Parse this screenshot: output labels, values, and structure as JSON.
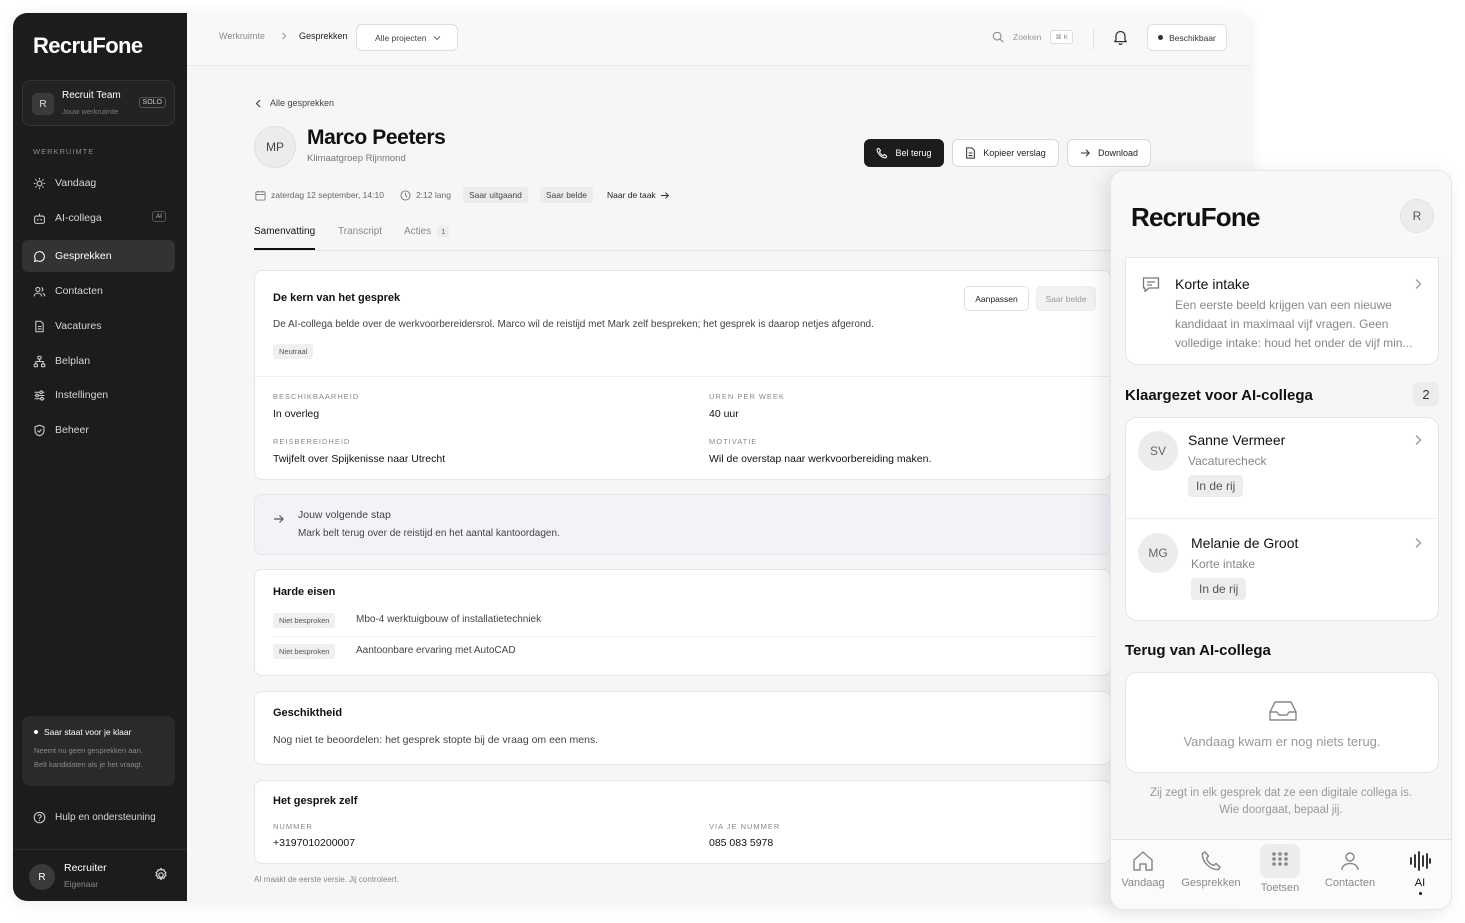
{
  "app": {
    "name": "RecruFone"
  },
  "sidebar": {
    "team_name": "Recruit Team",
    "team_sub": "Jouw werkruimte",
    "team_badge": "SOLO",
    "team_initial": "R",
    "section_label": "WERKRUIMTE",
    "items": [
      {
        "label": "Vandaag",
        "icon": "sun-icon"
      },
      {
        "label": "AI-collega",
        "icon": "robot-icon",
        "badge": "AI"
      },
      {
        "label": "Gesprekken",
        "icon": "chat-icon",
        "active": true
      },
      {
        "label": "Contacten",
        "icon": "people-icon"
      },
      {
        "label": "Vacatures",
        "icon": "document-icon"
      },
      {
        "label": "Belplan",
        "icon": "flow-icon"
      },
      {
        "label": "Instellingen",
        "icon": "sliders-icon"
      },
      {
        "label": "Beheer",
        "icon": "shield-icon"
      }
    ],
    "notice_title": "Saar staat voor je klaar",
    "notice_line1": "Neemt nu geen gesprekken aan.",
    "notice_line2": "Belt kandidaten als je het vraagt.",
    "help_label": "Hulp en ondersteuning",
    "user_name": "Recruiter",
    "user_role": "Eigenaar",
    "user_initial": "R"
  },
  "topbar": {
    "crumb_1": "Werkruimte",
    "crumb_2": "Gesprekken",
    "project_select": "Alle projecten",
    "search_label": "Zoeken",
    "search_shortcut": "⌘ K",
    "status_label": "Beschikbaar"
  },
  "conversation": {
    "back_label": "Alle gesprekken",
    "initials": "MP",
    "name": "Marco Peeters",
    "company": "Klimaatgroep Rijnmond",
    "date": "zaterdag 12 september, 14:10",
    "duration": "2:12 lang",
    "pill_1": "Saar uitgaand",
    "pill_2": "Saar belde",
    "task_link": "Naar de taak",
    "btn_call": "Bel terug",
    "btn_copy": "Kopieer verslag",
    "btn_download": "Download",
    "tabs": [
      {
        "label": "Samenvatting"
      },
      {
        "label": "Transcript"
      },
      {
        "label": "Acties",
        "count": "1"
      }
    ]
  },
  "summary": {
    "title": "De kern van het gesprek",
    "btn_edit": "Aanpassen",
    "btn_saar": "Saar belde",
    "text": "De AI-collega belde over de werkvoorbereidersrol. Marco wil de reistijd met Mark zelf bespreken; het gesprek is daarop netjes afgerond.",
    "sentiment": "Neutraal",
    "fields": [
      {
        "label": "BESCHIKBAARHEID",
        "value": "In overleg"
      },
      {
        "label": "UREN PER WEEK",
        "value": "40 uur"
      },
      {
        "label": "REISBEREIDHEID",
        "value": "Twijfelt over Spijkenisse naar Utrecht"
      },
      {
        "label": "MOTIVATIE",
        "value": "Wil de overstap naar werkvoorbereiding maken."
      }
    ]
  },
  "next_step": {
    "title": "Jouw volgende stap",
    "text": "Mark belt terug over de reistijd en het aantal kantoordagen."
  },
  "requirements": {
    "title": "Harde eisen",
    "items": [
      {
        "status": "Niet besproken",
        "text": "Mbo-4 werktuigbouw of installatietechniek"
      },
      {
        "status": "Niet besproken",
        "text": "Aantoonbare ervaring met AutoCAD"
      }
    ]
  },
  "suitability": {
    "title": "Geschiktheid",
    "text": "Nog niet te beoordelen: het gesprek stopte bij de vraag om een mens."
  },
  "call_info": {
    "title": "Het gesprek zelf",
    "number_label": "NUMMER",
    "number_value": "+3197010200007",
    "via_label": "VIA JE NUMMER",
    "via_value": "085 083 5978"
  },
  "footer_note": "AI maakt de eerste versie. Jij controleert.",
  "phone": {
    "avatar": "R",
    "intake_title": "Korte intake",
    "intake_text": "Een eerste beeld krijgen van een nieuwe kandidaat in maximaal vijf vragen. Geen volledige intake: houd het onder de vijf min...",
    "queued_title": "Klaargezet voor AI-collega",
    "queued_count": "2",
    "queued": [
      {
        "initials": "SV",
        "name": "Sanne Vermeer",
        "sub": "Vacaturecheck",
        "status": "In de rij"
      },
      {
        "initials": "MG",
        "name": "Melanie de Groot",
        "sub": "Korte intake",
        "status": "In de rij"
      }
    ],
    "back_title": "Terug van AI-collega",
    "empty_text": "Vandaag kwam er nog niets terug.",
    "disclaimer_1": "Zij zegt in elk gesprek dat ze een digitale collega is.",
    "disclaimer_2": "Wie doorgaat, bepaal jij.",
    "nav": [
      {
        "label": "Vandaag",
        "icon": "home-icon"
      },
      {
        "label": "Gesprekken",
        "icon": "phone-icon"
      },
      {
        "label": "Toetsen",
        "icon": "keypad-icon"
      },
      {
        "label": "Contacten",
        "icon": "person-icon"
      },
      {
        "label": "AI",
        "icon": "waveform-icon",
        "active": true
      }
    ]
  }
}
